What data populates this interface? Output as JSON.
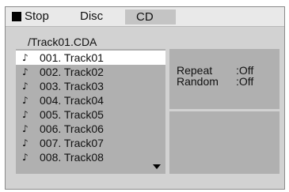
{
  "status": {
    "label": "Stop",
    "icon": "stop-icon"
  },
  "source": {
    "label": "Disc",
    "badge": "CD"
  },
  "path": "/Track01.CDA",
  "tracks": [
    {
      "label": "001. Track01",
      "selected": true
    },
    {
      "label": "002. Track02"
    },
    {
      "label": "003. Track03"
    },
    {
      "label": "004. Track04"
    },
    {
      "label": "005. Track05"
    },
    {
      "label": "006. Track06"
    },
    {
      "label": "007. Track07"
    },
    {
      "label": "008. Track08"
    }
  ],
  "note_glyph": "♪",
  "info": {
    "repeat_label": "Repeat",
    "repeat_value": ":Off",
    "random_label": "Random",
    "random_value": ":Off"
  }
}
